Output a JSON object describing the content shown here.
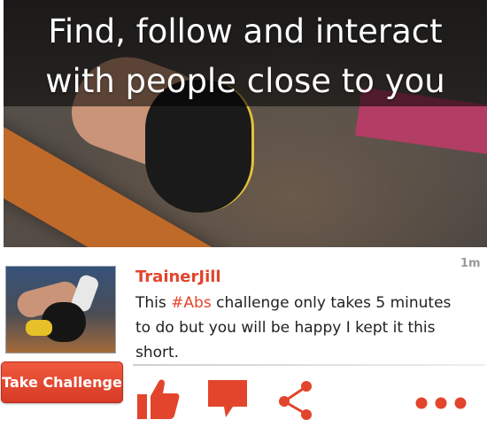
{
  "hero": {
    "title_line1": "Find, follow and interact",
    "title_line2": "with people close to you"
  },
  "post": {
    "username": "TrainerJill",
    "timestamp": "1m",
    "text_before_tag": "This ",
    "hashtag": "#Abs",
    "text_after_tag": " challenge only takes 5 minutes to do but you will be happy I kept it this short.",
    "take_challenge_label": "Take Challenge"
  },
  "actions": {
    "icons": [
      "thumbs-up-icon",
      "comment-icon",
      "share-icon",
      "more-icon"
    ]
  },
  "colors": {
    "accent": "#e2452c",
    "button_top": "#f05a3e",
    "button_bottom": "#d73a26"
  }
}
